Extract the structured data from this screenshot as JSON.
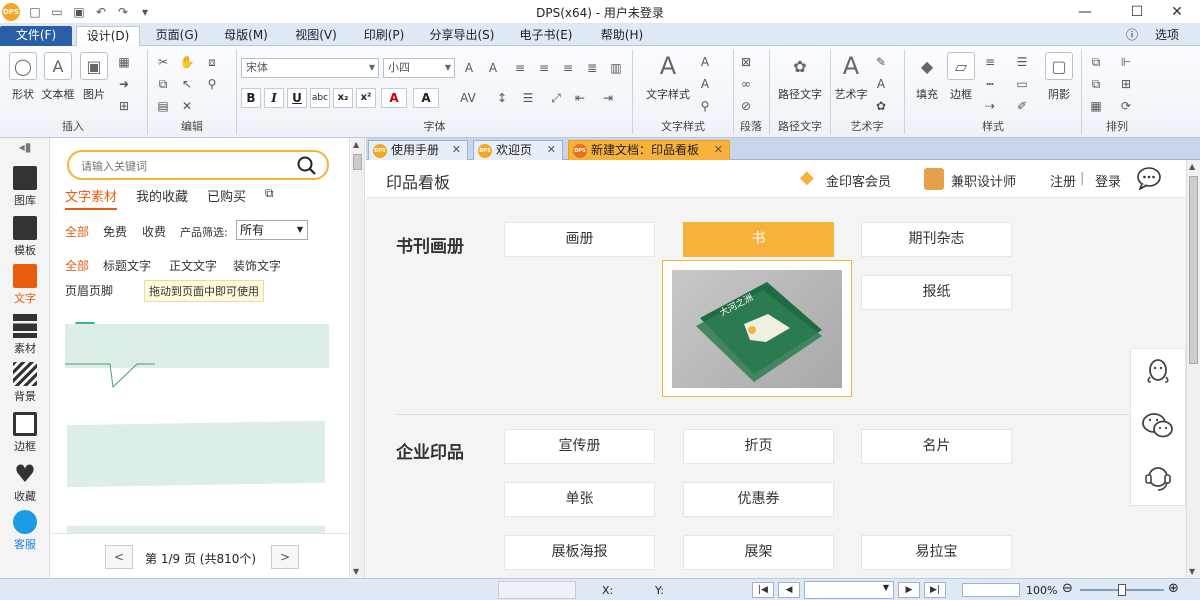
{
  "app": {
    "title": "DPS(x64) - 用户未登录",
    "logo": "DPS",
    "options_label": "选项"
  },
  "menu": {
    "file": "文件(F)",
    "tabs": [
      "设计(D)",
      "页面(G)",
      "母版(M)",
      "视图(V)",
      "印刷(P)",
      "分享导出(S)",
      "电子书(E)",
      "帮助(H)"
    ]
  },
  "ribbon": {
    "groups": [
      "插入",
      "编辑",
      "字体",
      "文字样式",
      "段落",
      "路径文字",
      "艺术字",
      "样式",
      "排列"
    ],
    "insert_buttons": [
      "形状",
      "文本框",
      "图片"
    ],
    "font_name": "宋体",
    "font_size": "小四",
    "text_style_label": "文字样式",
    "path_text_label": "路径文字",
    "art_text_label": "艺术字",
    "style_buttons": [
      "填充",
      "边框",
      "阴影"
    ]
  },
  "leftbar": {
    "items": [
      "图库",
      "模板",
      "文字",
      "素材",
      "背景",
      "边框",
      "收藏",
      "客服"
    ]
  },
  "panel": {
    "search_placeholder": "请输入关键词",
    "tabs": [
      "文字素材",
      "我的收藏",
      "已购买"
    ],
    "filter1": [
      "全部",
      "免费",
      "收费"
    ],
    "product_filter_label": "产品筛选:",
    "product_filter_value": "所有",
    "filter2": [
      "全部",
      "标题文字",
      "正文文字",
      "装饰文字"
    ],
    "filter3": "页眉页脚",
    "hint": "拖动到页面中即可使用",
    "pager": {
      "prev": "<",
      "next": ">",
      "text": "第 1/9 页 (共810个)"
    }
  },
  "doc_tabs": [
    "使用手册",
    "欢迎页",
    "新建文档：印品看板"
  ],
  "content": {
    "heading": "印品看板",
    "member": "金印客会员",
    "designer": "兼职设计师",
    "register": "注册",
    "login": "登录",
    "sections": [
      {
        "title": "书刊画册",
        "items": [
          "画册",
          "书",
          "期刊杂志",
          "报纸"
        ]
      },
      {
        "title": "企业印品",
        "items": [
          "宣传册",
          "折页",
          "名片",
          "单张",
          "优惠券",
          "展板海报",
          "展架",
          "易拉宝"
        ]
      }
    ],
    "book_cover_text": "大河之洲"
  },
  "status": {
    "x_label": "X:",
    "y_label": "Y:",
    "zoom": "100%"
  },
  "colors": {
    "accent": "#f7b23b",
    "active_text": "#e85c0d",
    "menu_bg": "#dfe8f5",
    "file_tab": "#2a5ea8"
  }
}
